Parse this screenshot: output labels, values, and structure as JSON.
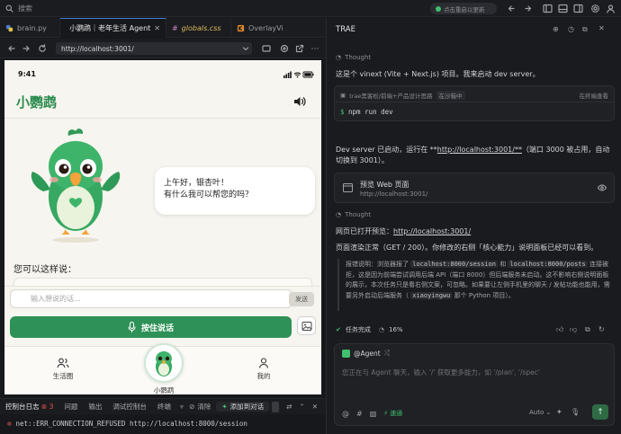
{
  "topbar": {
    "search_label": "搜索",
    "update_label": "点击重启以更新"
  },
  "tabs": [
    {
      "label": "brain.py",
      "icon": "python-icon"
    },
    {
      "label": "小鹦鹉｜老年生活 Agent",
      "icon": "eye-icon"
    },
    {
      "label": "globals.css",
      "icon": "css-hash-icon"
    },
    {
      "label": "OverlayVi",
      "icon": "react-icon"
    }
  ],
  "browser": {
    "url": "http://localhost:3001/"
  },
  "phone": {
    "time": "9:41",
    "app_title": "小鹦鹉",
    "bubble_line1": "上午好，银杏叶！",
    "bubble_line2": "有什么我可以帮您的吗？",
    "suggest_label": "您可以这样说：",
    "input_placeholder": "输入想说的话...",
    "send_label": "发送",
    "hold_label": "按住说话",
    "nav_community": "生活圈",
    "nav_parrot": "小鹦鹉",
    "nav_mine": "我的"
  },
  "panel": {
    "tabs": [
      "控制台日志",
      "问题",
      "输出",
      "调试控制台",
      "终端"
    ],
    "error_count": "3",
    "clear_label": "清除",
    "add_label": "添加到对话",
    "error_line": "net::ERR_CONNECTION_REFUSED http://localhost:8000/session"
  },
  "right": {
    "title": "TRAE",
    "thought_label": "Thought",
    "msg1": "这是个 vinext (Vite + Next.js) 项目。我来启动 dev server。",
    "terminal_header": "trae黑客松/前端+产品设计思路",
    "terminal_tag": "在沙箱中",
    "terminal_view": "在终端查看",
    "terminal_cmd": "npm run dev",
    "msg2_pre": "Dev server 已启动，运行在 **",
    "msg2_link": "http://localhost:3001/**",
    "msg2_post": "（端口 3000 被占用，自动切换到 3001）。",
    "preview_title": "预览 Web 页面",
    "preview_url": "http://localhost:3001/",
    "msg3_pre": "网页已打开预览：",
    "msg3_link": "http://localhost:3001/",
    "msg4": "页面渲染正常（GET / 200）。你修改的右侧「核心能力」说明面板已经可以看到。",
    "note_a": "报错说明：浏览器报了",
    "note_code1": "localhost:8000/session",
    "note_b": "和",
    "note_code2": "localhost:8000/posts",
    "note_c": "连接被拒，这是因为前端尝试调用后端 API（端口 8000）但后端服务未启动。这不影响右侧说明面板的展示，本次任务只是看右侧文案，可忽略。如果要让左侧手机里的聊天 / 发帖功能也能用，需要另外启动后端服务（",
    "note_code3": "xiaoyingwu",
    "note_d": "那个 Python 项目）。",
    "task_done": "任务完成",
    "task_percent": "16%",
    "agent_label": "@Agent",
    "input_placeholder": "您正在与 Agent 聊天，输入 '/' 获取更多能力，如 '/plan', '/spec'",
    "speed_label": "速通",
    "model_label": "Auto"
  },
  "colors": {
    "accent_green": "#2e9157",
    "title_green": "#2c8c4e",
    "error_red": "#e5534b",
    "link_blue": "#4a7bd6"
  }
}
